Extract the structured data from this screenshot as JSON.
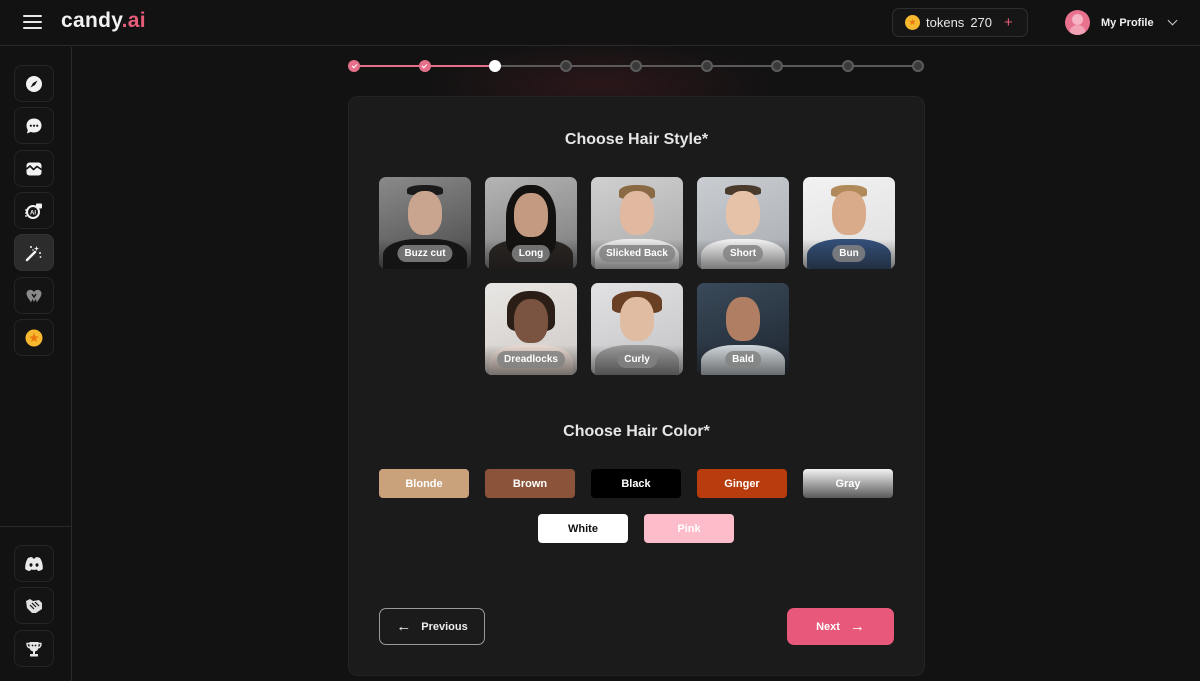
{
  "header": {
    "logo_main": "candy",
    "logo_accent": ".ai",
    "tokens_label": "tokens",
    "tokens_value": "270",
    "tokens_add": "+",
    "profile_name": "My Profile"
  },
  "sidebar": {
    "top_items": [
      {
        "icon": "compass-icon",
        "label": "Explore"
      },
      {
        "icon": "chat-icon",
        "label": "Chat"
      },
      {
        "icon": "gallery-icon",
        "label": "Gallery"
      },
      {
        "icon": "ai-camera-icon",
        "label": "Generate Image"
      },
      {
        "icon": "magic-wand-icon",
        "label": "Create Character",
        "active": true
      },
      {
        "icon": "heart-icon",
        "label": "My AI"
      },
      {
        "icon": "star-coin-icon",
        "label": "Premium"
      }
    ],
    "bottom_items": [
      {
        "icon": "discord-icon",
        "label": "Discord"
      },
      {
        "icon": "handshake-icon",
        "label": "Affiliate"
      },
      {
        "icon": "trophy-icon",
        "label": "Leaderboard"
      }
    ]
  },
  "progress": {
    "total_steps": 9,
    "completed_steps": 2,
    "current_step": 3
  },
  "hair_style": {
    "title": "Choose Hair Style*",
    "options": [
      {
        "label": "Buzz cut"
      },
      {
        "label": "Long"
      },
      {
        "label": "Slicked Back"
      },
      {
        "label": "Short"
      },
      {
        "label": "Bun"
      },
      {
        "label": "Dreadlocks"
      },
      {
        "label": "Curly"
      },
      {
        "label": "Bald"
      }
    ]
  },
  "hair_color": {
    "title": "Choose Hair Color*",
    "options": [
      {
        "label": "Blonde",
        "color": "#c9a27c",
        "text": "#ffffff"
      },
      {
        "label": "Brown",
        "color": "#8b5339",
        "text": "#ffffff"
      },
      {
        "label": "Black",
        "color": "#000000",
        "text": "#ffffff"
      },
      {
        "label": "Ginger",
        "color": "#b83c0d",
        "text": "#ffffff"
      },
      {
        "label": "Gray",
        "color": "#9a9a9a",
        "text": "#ffffff"
      },
      {
        "label": "White",
        "color": "#ffffff",
        "text": "#111111"
      },
      {
        "label": "Pink",
        "color": "#fdbcc9",
        "text": "#ffffff"
      }
    ]
  },
  "nav": {
    "previous_label": "Previous",
    "next_label": "Next"
  },
  "colors": {
    "accent": "#e8587a",
    "background": "#121212",
    "card": "#1b1b1b"
  }
}
